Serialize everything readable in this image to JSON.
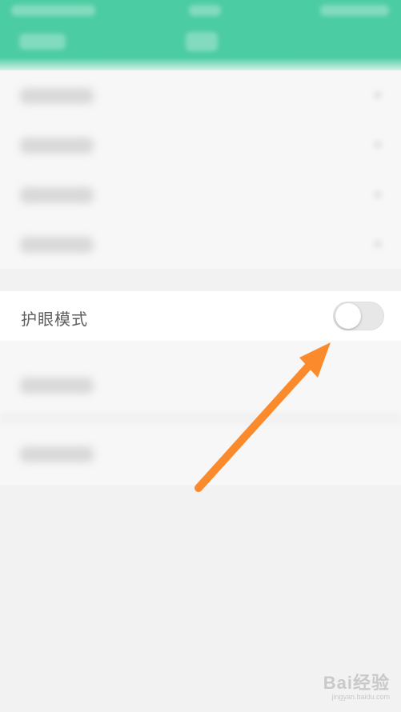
{
  "settings": {
    "eye_care_mode": {
      "label": "护眼模式",
      "enabled": false
    }
  },
  "annotation": {
    "arrow_color": "#fb8a2c"
  },
  "watermark": {
    "main": "Bai经验",
    "sub": "jingyan.baidu.com"
  },
  "colors": {
    "header": "#4ccca2",
    "background": "#f2f2f2",
    "row_background": "#ffffff",
    "switch_off": "#e7e7e7"
  }
}
